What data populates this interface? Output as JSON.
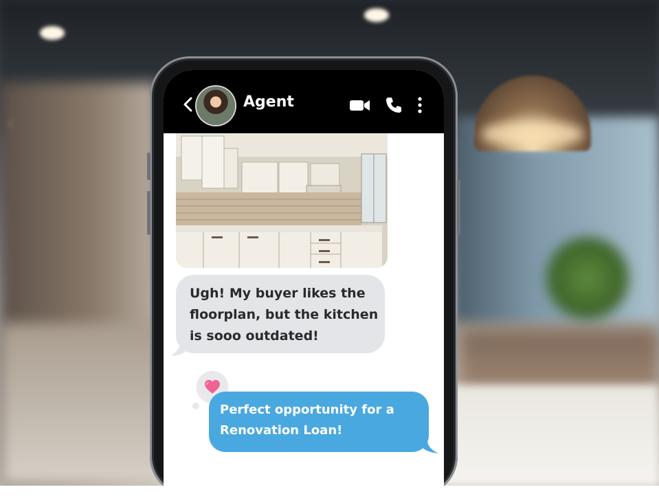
{
  "chat": {
    "contact_name": "Agent",
    "messages": [
      {
        "direction": "incoming",
        "text": "Ugh! My buyer likes the floorplan, but the kitchen is sooo outdated!"
      },
      {
        "direction": "outgoing",
        "text": "Perfect opportunity for a Renovation Loan!"
      }
    ]
  },
  "icons": {
    "back": "chevron-left-icon",
    "video": "video-camera-icon",
    "call": "phone-icon",
    "more": "more-vertical-icon",
    "reaction": "heart-icon"
  },
  "colors": {
    "topbar": "#000000",
    "incoming_bubble": "#e4e5e8",
    "outgoing_bubble": "#4aa8e0",
    "reaction_heart": "#f06292"
  }
}
